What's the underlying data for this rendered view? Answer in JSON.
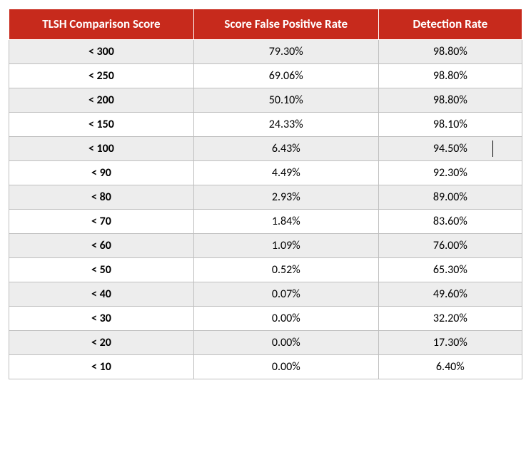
{
  "chart_data": {
    "type": "table",
    "columns": [
      "TLSH Comparison Score",
      "Score False Positive Rate",
      "Detection Rate"
    ],
    "rows": [
      {
        "score": "< 300",
        "fpr": "79.30%",
        "dr": "98.80%"
      },
      {
        "score": "< 250",
        "fpr": "69.06%",
        "dr": "98.80%"
      },
      {
        "score": "< 200",
        "fpr": "50.10%",
        "dr": "98.80%"
      },
      {
        "score": "< 150",
        "fpr": "24.33%",
        "dr": "98.10%"
      },
      {
        "score": "< 100",
        "fpr": "6.43%",
        "dr": "94.50%"
      },
      {
        "score": "< 90",
        "fpr": "4.49%",
        "dr": "92.30%"
      },
      {
        "score": "< 80",
        "fpr": "2.93%",
        "dr": "89.00%"
      },
      {
        "score": "< 70",
        "fpr": "1.84%",
        "dr": "83.60%"
      },
      {
        "score": "< 60",
        "fpr": "1.09%",
        "dr": "76.00%"
      },
      {
        "score": "< 50",
        "fpr": "0.52%",
        "dr": "65.30%"
      },
      {
        "score": "< 40",
        "fpr": "0.07%",
        "dr": "49.60%"
      },
      {
        "score": "< 30",
        "fpr": "0.00%",
        "dr": "32.20%"
      },
      {
        "score": "< 20",
        "fpr": "0.00%",
        "dr": "17.30%"
      },
      {
        "score": "< 10",
        "fpr": "0.00%",
        "dr": "6.40%"
      }
    ]
  }
}
